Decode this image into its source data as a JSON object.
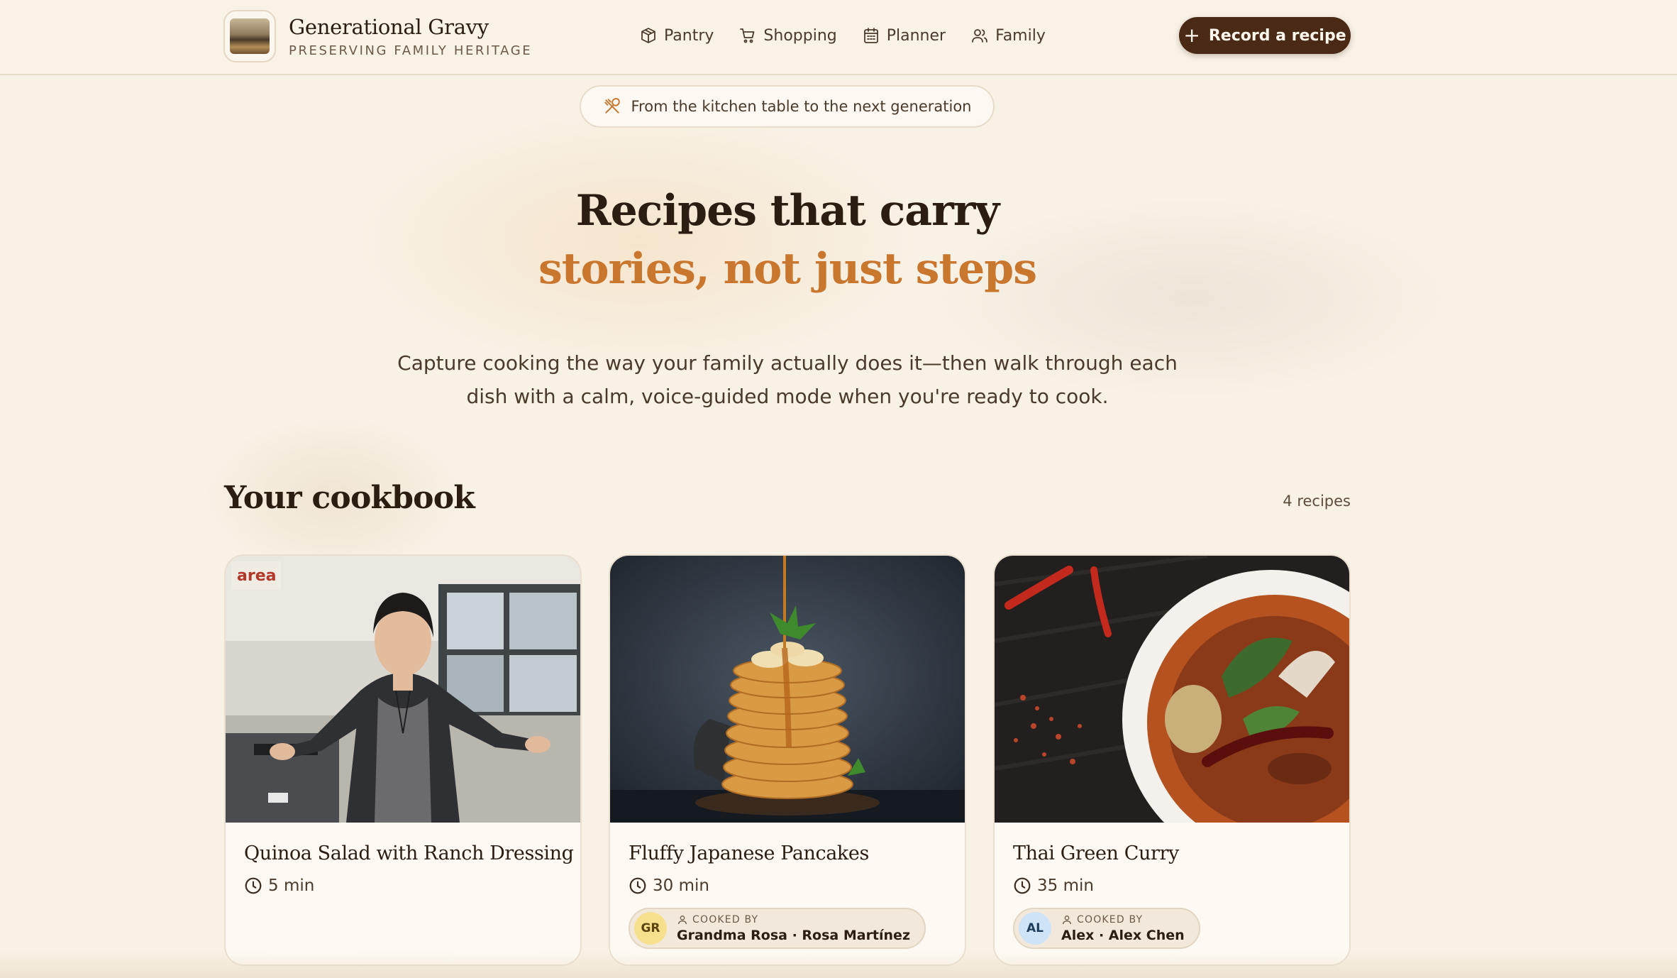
{
  "brand": {
    "title": "Generational Gravy",
    "subtitle": "PRESERVING FAMILY HERITAGE"
  },
  "nav": {
    "items": [
      {
        "label": "Pantry",
        "icon": "box-icon"
      },
      {
        "label": "Shopping",
        "icon": "cart-icon"
      },
      {
        "label": "Planner",
        "icon": "calendar-icon"
      },
      {
        "label": "Family",
        "icon": "users-icon"
      }
    ]
  },
  "actions": {
    "record_label": "Record a recipe"
  },
  "tagline": {
    "text": "From the kitchen table to the next generation"
  },
  "hero": {
    "line1": "Recipes that carry",
    "line2": "stories, not just steps",
    "description": "Capture cooking the way your family actually does it—then walk through each dish with a calm, voice-guided mode when you're ready to cook."
  },
  "cookbook": {
    "title": "Your cookbook",
    "count": "4 recipes",
    "cooked_by_label": "COOKED BY",
    "recipes": [
      {
        "title": "Quinoa Salad with Ranch Dressing",
        "time": "5 min"
      },
      {
        "title": "Fluffy Japanese Pancakes",
        "time": "30 min",
        "cook_initials": "GR",
        "cook_name": "Grandma Rosa · Rosa Martínez"
      },
      {
        "title": "Thai Green Curry",
        "time": "35 min",
        "cook_initials": "AL",
        "cook_name": "Alex · Alex Chen"
      }
    ]
  },
  "colors": {
    "background": "#f8f1e5",
    "accent": "#c9762e",
    "button": "#4a2a17",
    "avatar_gr": "#f6e08e",
    "avatar_al": "#cfe3f7"
  }
}
